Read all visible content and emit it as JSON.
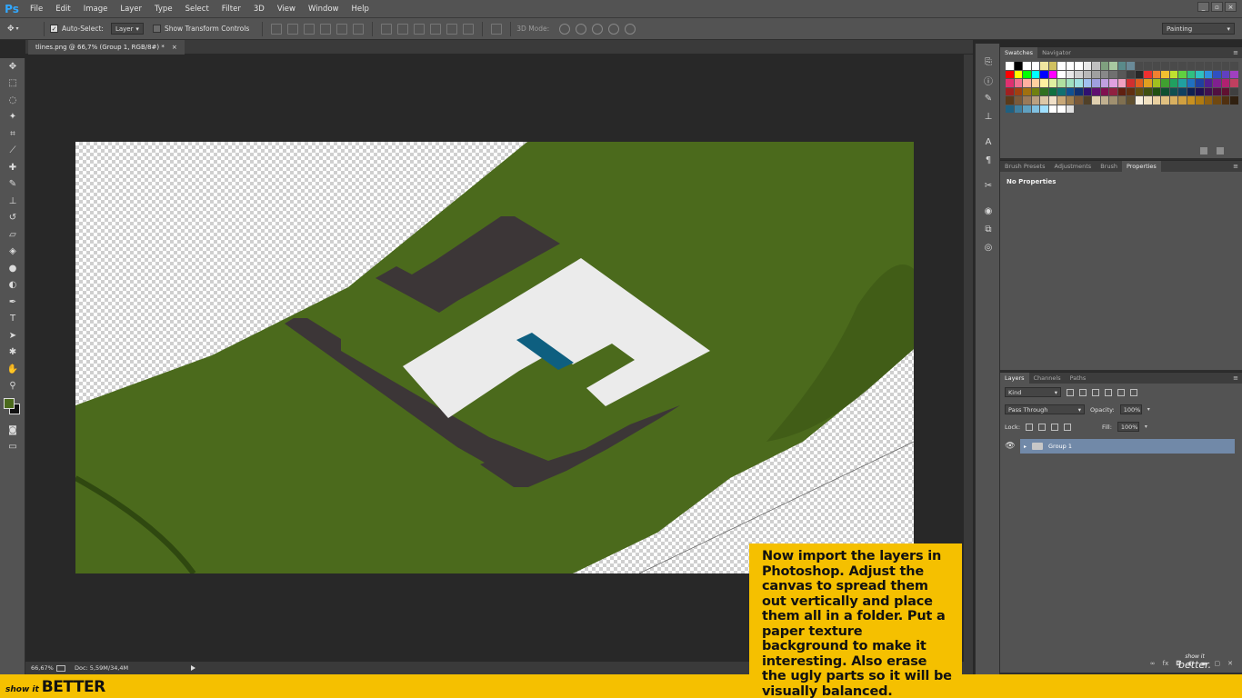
{
  "app": {
    "logo": "Ps"
  },
  "menu": [
    "File",
    "Edit",
    "Image",
    "Layer",
    "Type",
    "Select",
    "Filter",
    "3D",
    "View",
    "Window",
    "Help"
  ],
  "options": {
    "auto_select_label": "Auto-Select:",
    "auto_select_value": "Layer",
    "transform_label": "Show Transform Controls",
    "mode3d_label": "3D Mode:",
    "workspace": "Painting"
  },
  "document": {
    "tab_title": "tlines.png @ 66,7% (Group 1, RGB/8#) *",
    "close_glyph": "×",
    "zoom": "66,67%",
    "doc_size": "Doc: 5,59M/34,4M"
  },
  "panels": {
    "top_tabs": [
      "Swatches",
      "Navigator"
    ],
    "mid_tabs": [
      "Brush Presets",
      "Adjustments",
      "Brush",
      "Properties"
    ],
    "no_properties": "No Properties",
    "layer_tabs": [
      "Layers",
      "Channels",
      "Paths"
    ],
    "kind_label": "Kind",
    "blend_mode": "Pass Through",
    "opacity_label": "Opacity:",
    "opacity_value": "100%",
    "lock_label": "Lock:",
    "fill_label": "Fill:",
    "fill_value": "100%",
    "layer_name": "Group 1"
  },
  "colors": {
    "green": "#4b6a1c",
    "dark_building": "#3c3637",
    "white_building": "#ebebeb",
    "blue_pool": "#0e5f80",
    "caption_bg": "#f5c000"
  },
  "swatches": [
    "#ffffff",
    "#000000",
    "#ffffff",
    "#ffffff",
    "#f0e6a0",
    "#d0c060",
    "#ffffff",
    "#ffffff",
    "#ffffff",
    "#e9e9e9",
    "#c0c0c0",
    "#7fa07f",
    "#a8c8a0",
    "#5a8a8a",
    "#6a8a98",
    "#4a4a4a",
    "#4a4a4a",
    "#4a4a4a",
    "#4a4a4a",
    "#4a4a4a",
    "#4a4a4a",
    "#4a4a4a",
    "#4a4a4a",
    "#4a4a4a",
    "#4a4a4a",
    "#4a4a4a",
    "#4a4a4a",
    "#ff0000",
    "#ffff00",
    "#00ff00",
    "#00ffff",
    "#0000ff",
    "#ff00ff",
    "#ffffff",
    "#e8e8e8",
    "#d0d0d0",
    "#b8b8b8",
    "#a0a0a0",
    "#888888",
    "#707070",
    "#585858",
    "#404040",
    "#282828",
    "#ee3030",
    "#f08030",
    "#f0c030",
    "#c0e030",
    "#60d040",
    "#30c080",
    "#30c0c0",
    "#3090e0",
    "#3050c0",
    "#6040c0",
    "#a040c0",
    "#e03070",
    "#f07090",
    "#ffb0a0",
    "#ffd0a0",
    "#fff0a0",
    "#e0f0a0",
    "#b0e0a0",
    "#a0e0c0",
    "#a0e0e0",
    "#a0c0f0",
    "#a0a0e0",
    "#c0a0e0",
    "#e0a0e0",
    "#f0a0c0",
    "#d03030",
    "#e06020",
    "#e0a020",
    "#a0c020",
    "#40a030",
    "#20a060",
    "#20a0a0",
    "#2070c0",
    "#2040a0",
    "#502090",
    "#802090",
    "#b02070",
    "#c04060",
    "#a02020",
    "#a04010",
    "#a07010",
    "#708010",
    "#307020",
    "#107040",
    "#107070",
    "#105090",
    "#103070",
    "#301070",
    "#601070",
    "#801050",
    "#902040",
    "#602010",
    "#603010",
    "#605010",
    "#405010",
    "#205010",
    "#105030",
    "#105050",
    "#104060",
    "#102050",
    "#201050",
    "#401050",
    "#501040",
    "#601030",
    "#404040",
    "#5a3a1a",
    "#7a5a3a",
    "#9a7a5a",
    "#bba080",
    "#dcc8a8",
    "#f0e0c8",
    "#c8a878",
    "#a08050",
    "#785838",
    "#504028",
    "#e0d0b0",
    "#c0b090",
    "#a09070",
    "#807050",
    "#605030",
    "#f8f0e0",
    "#f0e0c0",
    "#e8d0a0",
    "#e0c080",
    "#d8b060",
    "#d0a040",
    "#c89020",
    "#b07a10",
    "#906010",
    "#704810",
    "#503010",
    "#302010",
    "#206080",
    "#4080a0",
    "#60a0c0",
    "#80c0e0",
    "#a0e0ff",
    "#ffffff",
    "#ffffff",
    "#e0e0e0"
  ]
}
